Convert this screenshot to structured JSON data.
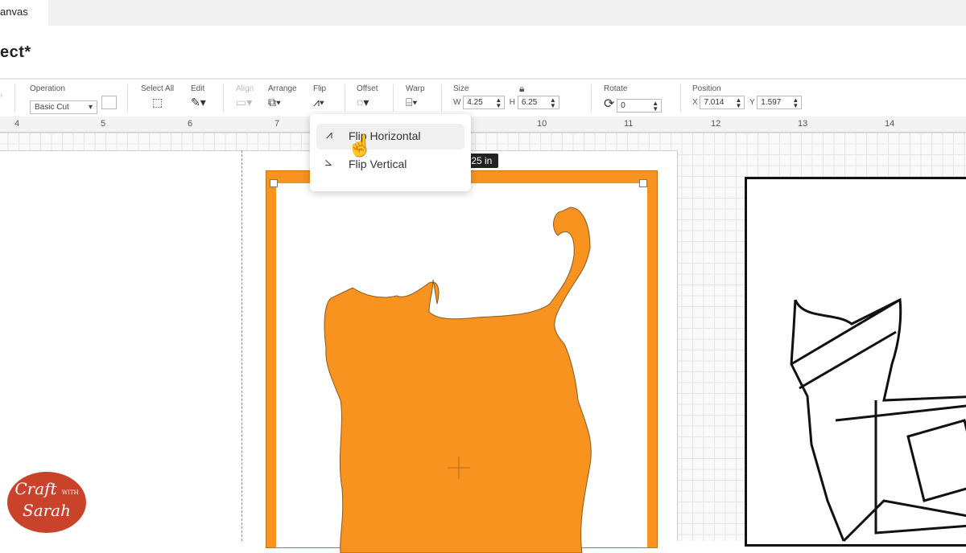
{
  "tab": {
    "label": "anvas"
  },
  "project": {
    "title": "ect*"
  },
  "toolbar": {
    "operation": {
      "label": "Operation",
      "value": "Basic Cut"
    },
    "select_all": {
      "label": "Select All"
    },
    "edit": {
      "label": "Edit"
    },
    "align": {
      "label": "Align"
    },
    "arrange": {
      "label": "Arrange"
    },
    "flip": {
      "label": "Flip"
    },
    "offset": {
      "label": "Offset"
    },
    "warp": {
      "label": "Warp"
    },
    "size": {
      "label": "Size",
      "w_label": "W",
      "w": "4.25",
      "h_label": "H",
      "h": "6.25"
    },
    "rotate": {
      "label": "Rotate",
      "value": "0"
    },
    "position": {
      "label": "Position",
      "x_label": "X",
      "x": "7.014",
      "y_label": "Y",
      "y": "1.597"
    }
  },
  "ruler": [
    "4",
    "5",
    "6",
    "7",
    "10",
    "11",
    "12",
    "13",
    "14"
  ],
  "flip_menu": {
    "items": [
      "Flip Horizontal",
      "Flip Vertical"
    ]
  },
  "dimension_tag": "4.25 in",
  "dimension_tag_visible": ".25 in",
  "logo": {
    "line1": "Craft",
    "line2": "WITH",
    "line3": "Sarah"
  },
  "colors": {
    "accent": "#f7931e",
    "logo": "#c9432a"
  }
}
